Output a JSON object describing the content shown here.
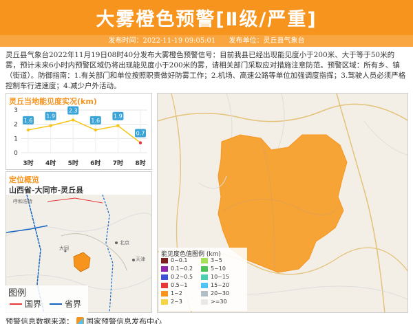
{
  "header": {
    "title": "大雾橙色预警[Ⅱ级/严重]",
    "publish_time_label": "发布时间：2022-11-19 09:05:01",
    "publisher_label": "发布单位：灵丘县气象台"
  },
  "description": "灵丘县气象台2022年11月19日08时40分发布大雾橙色预警信号：目前我县已经出现能见度小于200米、大于等于50米的雾，预计未来6小时内预警区域仍将出现能见度小于200米的雾，请相关部门采取应对措施注意防范。预警区域：所有乡、镇（街道）。防御指南：1.有关部门和单位按照职责做好防雾工作；2.机场、高速公路等单位加强调度指挥；3.驾驶人员必须严格控制车行进速度；4.减少户外活动。",
  "visibility_panel": {
    "title": "灵丘当地能见度实况(km)",
    "chart_data": {
      "type": "line",
      "categories": [
        "3时",
        "4时",
        "5时",
        "6时",
        "7时",
        "8时"
      ],
      "values": [
        1.6,
        1.9,
        2.3,
        1.6,
        1.9,
        0.7
      ],
      "value_labels": [
        "1.6",
        "1.9",
        "2.3",
        "1.6",
        "1.9",
        "0.7"
      ],
      "y_ticks": [
        "0",
        "1",
        "2",
        "3"
      ],
      "ylim": [
        0,
        3
      ],
      "colors": {
        "line": "#f5c518",
        "label_bg": "#3aa3d8",
        "last_point": "#e53935"
      }
    }
  },
  "location_panel": {
    "title": "定位概览",
    "location": "山西省-大同市-灵丘县",
    "map_labels": {
      "hohhot": "呼和浩特",
      "beijing": "北京",
      "tianjin": "天津",
      "datong": "大同"
    },
    "legend_title": "图例",
    "legend_items": [
      {
        "label": "国界",
        "color": "#e53935"
      },
      {
        "label": "省界",
        "color": "#1565c0"
      }
    ]
  },
  "visibility_legend": {
    "title": "能见度色值图例 (km)",
    "items": [
      {
        "label": "0~0.1",
        "color": "#7b1e1e"
      },
      {
        "label": "3~5",
        "color": "#a6e15a"
      },
      {
        "label": "0.1~0.2",
        "color": "#8e24aa"
      },
      {
        "label": "5~10",
        "color": "#4fc35a"
      },
      {
        "label": "0.2~0.5",
        "color": "#3f51d8"
      },
      {
        "label": "10~15",
        "color": "#4dd0b0"
      },
      {
        "label": "0.5~1",
        "color": "#e53935"
      },
      {
        "label": "15~20",
        "color": "#4fc3f7"
      },
      {
        "label": "1~2",
        "color": "#f7941d"
      },
      {
        "label": "20~30",
        "color": "#b0bec5"
      },
      {
        "label": "2~3",
        "color": "#f5d547"
      },
      {
        "label": ">=30",
        "color": "#e8e8e8"
      }
    ]
  },
  "footer": {
    "source_label": "预警信息数据来源：",
    "source_name": "国家预警信息发布中心"
  }
}
